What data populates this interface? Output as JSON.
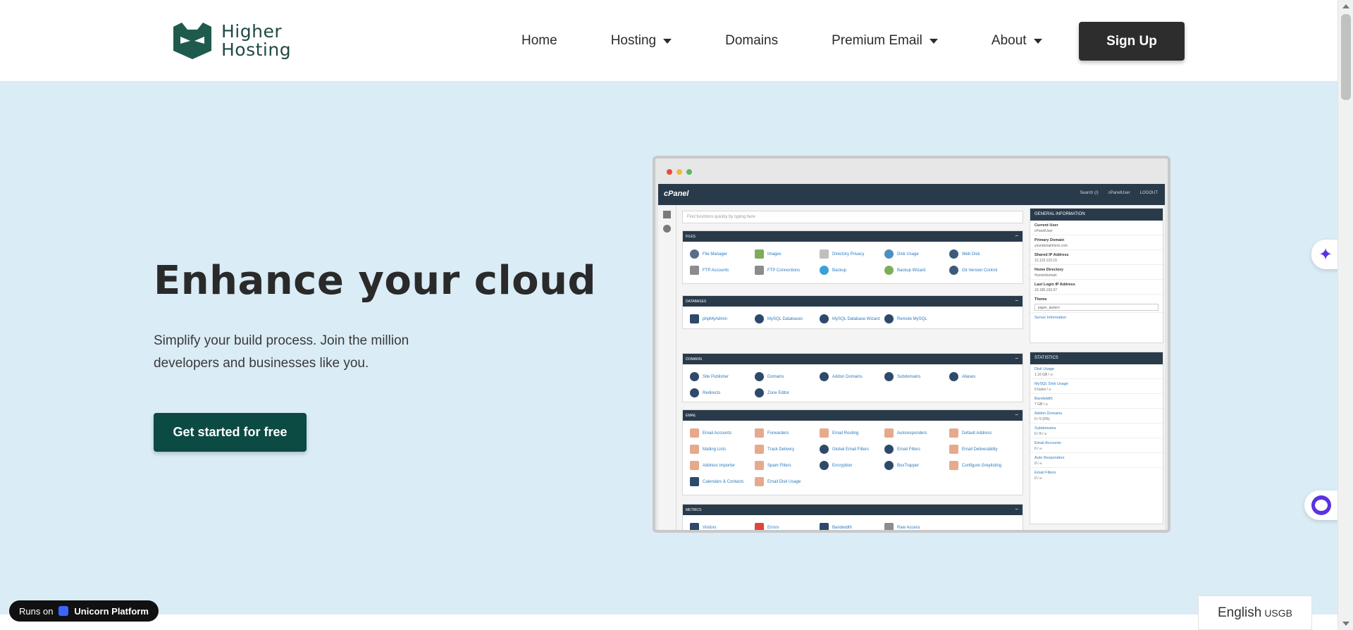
{
  "header": {
    "logo_text_line1": "Higher",
    "logo_text_line2": "Hosting",
    "nav": {
      "home": "Home",
      "hosting": "Hosting",
      "domains": "Domains",
      "premium_email": "Premium Email",
      "about": "About"
    },
    "signup_label": "Sign Up"
  },
  "hero": {
    "title": "Enhance your cloud",
    "subtitle": "Simplify your build process. Join the million developers and businesses like you.",
    "cta_label": "Get started for free",
    "background": "#daecf6"
  },
  "cpanel": {
    "logo": "cPanel",
    "top_right": [
      "Search (/)",
      "cPanelUser",
      "LOGOUT"
    ],
    "search_placeholder": "Find functions quickly by typing here",
    "panels": [
      {
        "title": "FILES",
        "items": [
          "File Manager",
          "Images",
          "Directory Privacy",
          "Disk Usage",
          "Web Disk",
          "FTP Accounts",
          "FTP Connections",
          "Backup",
          "Backup Wizard",
          "Git Version Control"
        ]
      },
      {
        "title": "DATABASES",
        "items": [
          "phpMyAdmin",
          "MySQL Databases",
          "MySQL Database Wizard",
          "Remote MySQL"
        ]
      },
      {
        "title": "DOMAINS",
        "items": [
          "Site Publisher",
          "Domains",
          "Addon Domains",
          "Subdomains",
          "Aliases",
          "Redirects",
          "Zone Editor"
        ]
      },
      {
        "title": "EMAIL",
        "items": [
          "Email Accounts",
          "Forwarders",
          "Email Routing",
          "Autoresponders",
          "Default Address",
          "Mailing Lists",
          "Track Delivery",
          "Global Email Filters",
          "Email Filters",
          "Email Deliverability",
          "Address Importer",
          "Spam Filters",
          "Encryption",
          "BoxTrapper",
          "Configure Greylisting",
          "Calendars & Contacts",
          "Email Disk Usage"
        ]
      },
      {
        "title": "METRICS",
        "items": [
          "Visitors",
          "Errors",
          "Bandwidth",
          "Raw Access"
        ]
      }
    ],
    "general_info": {
      "title": "GENERAL INFORMATION",
      "rows": [
        {
          "label": "Current User",
          "value": "cPanelUser"
        },
        {
          "label": "Primary Domain",
          "value": "yourdomainhere.com"
        },
        {
          "label": "Shared IP Address",
          "value": "12.123.123.15"
        },
        {
          "label": "Home Directory",
          "value": "/home/domain"
        },
        {
          "label": "Last Login IP Address",
          "value": "19.185.192.97"
        }
      ],
      "theme_label": "Theme",
      "theme_value": "paper_lantern",
      "server_info": "Server Information"
    },
    "statistics": {
      "title": "STATISTICS",
      "rows": [
        {
          "label": "Disk Usage",
          "value": "1.16 GB / ∞"
        },
        {
          "label": "MySQL Disk Usage",
          "value": "0 bytes / ∞"
        },
        {
          "label": "Bandwidth",
          "value": "7 GB / ∞"
        },
        {
          "label": "Addon Domains",
          "value": "0 / 5 (0%)"
        },
        {
          "label": "Subdomains",
          "value": "0 / 8 / ∞"
        },
        {
          "label": "Email Accounts",
          "value": "0 / ∞"
        },
        {
          "label": "Auto Responders",
          "value": "0 / ∞"
        },
        {
          "label": "Email Filters",
          "value": "0 / ∞"
        }
      ]
    }
  },
  "widgets": {
    "runs_on_prefix": "Runs on",
    "runs_on_brand": "Unicorn Platform",
    "language": "English",
    "currency": "USGB"
  },
  "colors": {
    "dark_green": "#0c4a44",
    "header_dark": "#2d2d2d",
    "cpanel_navy": "#293a4a",
    "accent_purple": "#5a33e0"
  }
}
